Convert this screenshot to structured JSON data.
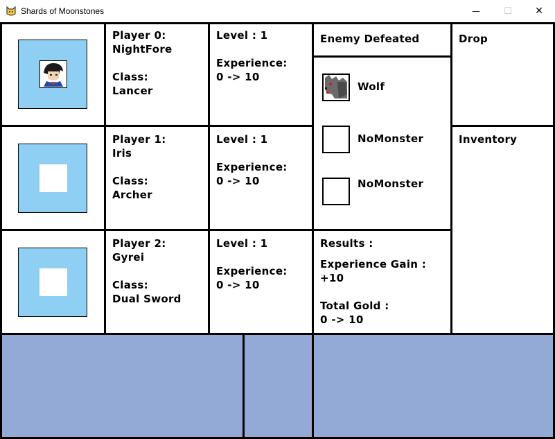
{
  "window": {
    "title": "Shards of Moonstones",
    "minimize_glyph": "—",
    "maximize_glyph": "☐",
    "close_glyph": "✕",
    "icon": "cat-face-icon"
  },
  "players": [
    {
      "name_line": "Player 0:",
      "name": "NightFore",
      "class_label": "Class:",
      "class": "Lancer",
      "level": "Level : 1",
      "exp_label": "Experience:",
      "exp": "0 -> 10",
      "portrait": "knight-portrait-icon"
    },
    {
      "name_line": "Player 1:",
      "name": "Iris",
      "class_label": "Class:",
      "class": "Archer",
      "level": "Level : 1",
      "exp_label": "Experience:",
      "exp": "0 -> 10",
      "portrait": "empty-portrait"
    },
    {
      "name_line": "Player 2:",
      "name": "Gyrei",
      "class_label": "Class:",
      "class": "Dual Sword",
      "level": "Level : 1",
      "exp_label": "Experience:",
      "exp": "0 -> 10",
      "portrait": "empty-portrait"
    }
  ],
  "enemy_header": "Enemy Defeated",
  "enemies": [
    {
      "name": "Wolf",
      "icon": "wolf-icon"
    },
    {
      "name": "NoMonster",
      "icon": "empty-slot"
    },
    {
      "name": "NoMonster",
      "icon": "empty-slot"
    }
  ],
  "results": {
    "title": "Results :",
    "exp_gain_label": "Experience Gain :",
    "exp_gain_value": "+10",
    "gold_label": "Total Gold :",
    "gold_value": "0 -> 10"
  },
  "drop_label": "Drop",
  "inventory_label": "Inventory",
  "colors": {
    "portrait_bg": "#8ecff3",
    "panel_bg": "#93a9d6",
    "border": "#000000"
  }
}
